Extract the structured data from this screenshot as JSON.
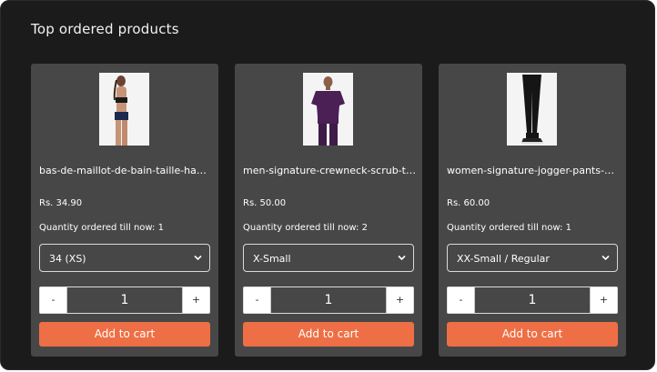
{
  "section": {
    "title": "Top ordered products"
  },
  "colors": {
    "panel": "#1b1b1b",
    "card": "#474747",
    "accent": "#ee6f45"
  },
  "products": [
    {
      "name": "bas-de-maillot-de-bain-taille-ha…",
      "price": "Rs. 34.90",
      "ordered": "Quantity ordered till now: 1",
      "variant": "34 (XS)",
      "minus": "-",
      "quantity": "1",
      "plus": "+",
      "cta": "Add to cart",
      "image_icon": "product-photo-swimwear"
    },
    {
      "name": "men-signature-crewneck-scrub-t…",
      "price": "Rs. 50.00",
      "ordered": "Quantity ordered till now: 2",
      "variant": "X-Small",
      "minus": "-",
      "quantity": "1",
      "plus": "+",
      "cta": "Add to cart",
      "image_icon": "product-photo-scrub-top"
    },
    {
      "name": "women-signature-jogger-pants-…",
      "price": "Rs. 60.00",
      "ordered": "Quantity ordered till now: 1",
      "variant": "XX-Small / Regular",
      "minus": "-",
      "quantity": "1",
      "plus": "+",
      "cta": "Add to cart",
      "image_icon": "product-photo-jogger-pants"
    }
  ]
}
